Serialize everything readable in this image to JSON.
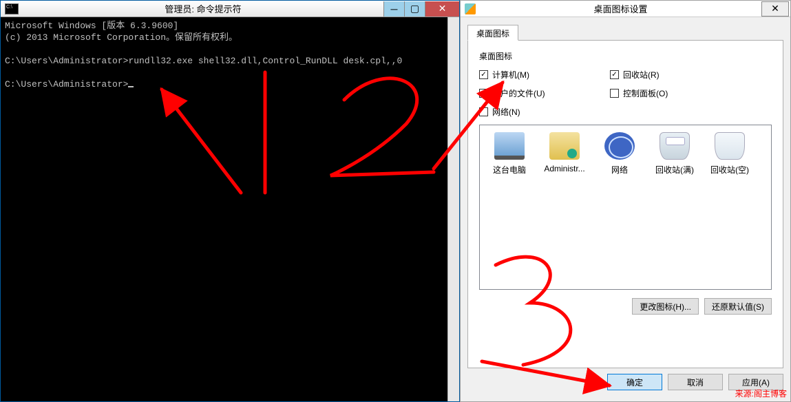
{
  "cmd": {
    "title": "管理员: 命令提示符",
    "line1": "Microsoft Windows [版本 6.3.9600]",
    "line2": "(c) 2013 Microsoft Corporation。保留所有权利。",
    "prompt1": "C:\\Users\\Administrator>",
    "command": "rundll32.exe shell32.dll,Control_RunDLL desk.cpl,,0",
    "prompt2": "C:\\Users\\Administrator>"
  },
  "dlg": {
    "title": "桌面图标设置",
    "tab": "桌面图标",
    "group": "桌面图标",
    "checks": {
      "computer": {
        "label": "计算机(M)",
        "checked": true
      },
      "recycle": {
        "label": "回收站(R)",
        "checked": true
      },
      "userfile": {
        "label": "用户的文件(U)",
        "checked": false
      },
      "cpanel": {
        "label": "控制面板(O)",
        "checked": false
      },
      "network": {
        "label": "网络(N)",
        "checked": false
      }
    },
    "icons": {
      "pc": "这台电脑",
      "user": "Administr...",
      "net": "网络",
      "binf": "回收站(满)",
      "bine": "回收站(空)"
    },
    "buttons": {
      "change": "更改图标(H)...",
      "restore": "还原默认值(S)",
      "ok": "确定",
      "cancel": "取消",
      "apply": "应用(A)"
    }
  },
  "credit": "来源:阁主博客"
}
